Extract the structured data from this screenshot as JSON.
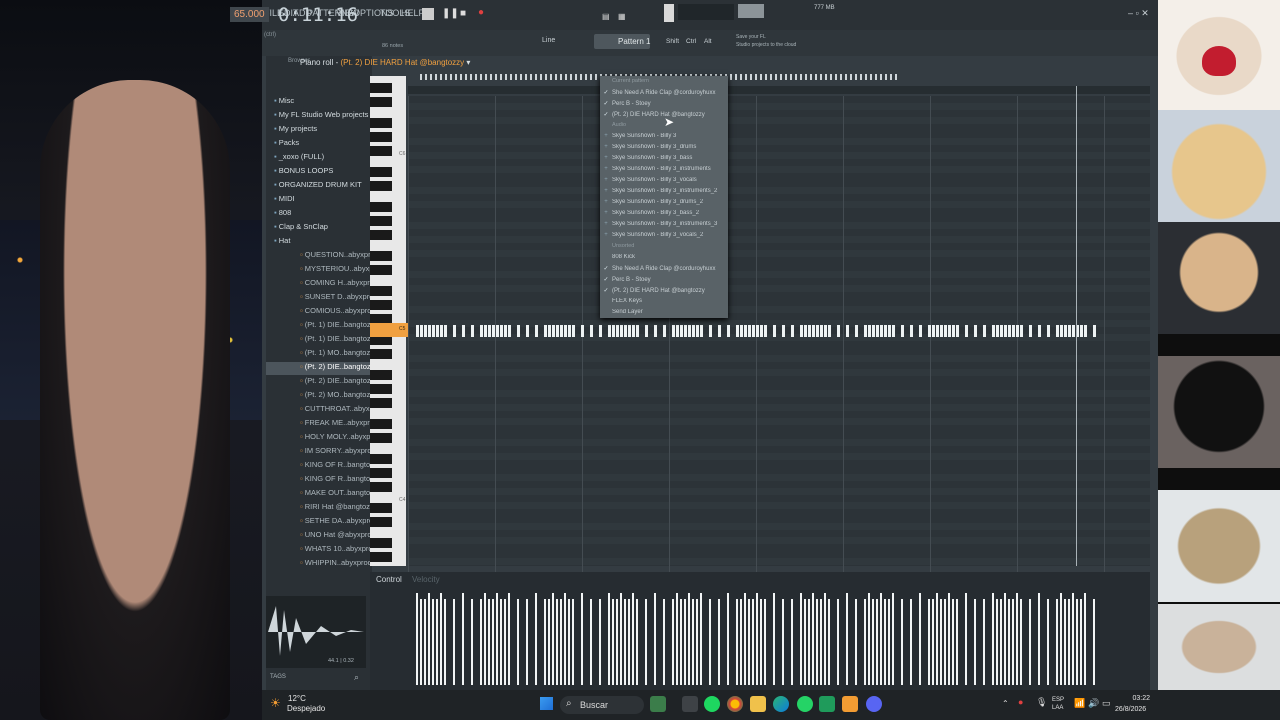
{
  "menu": [
    "FILE",
    "EDIT",
    "ADD",
    "PATTERNS",
    "VIEW",
    "OPTIONS",
    "TOOLS",
    "HELP"
  ],
  "transport": {
    "tempo": "65.000",
    "time": "0:11:16",
    "memory": "777 MB"
  },
  "hint": {
    "title": "Save your FL",
    "subtitle": "Studio projects to the cloud"
  },
  "toolbar": {
    "notes": "86 notes",
    "pattern": "Pattern 1",
    "snap": "Line",
    "shift": "Shift",
    "alt": "Alt"
  },
  "piano_roll": {
    "label": "Piano roll",
    "channel": "(Pt. 2) DIE HARD Hat @bangtozzy",
    "octave_c6": "C6",
    "octave_c5": "C5",
    "octave_c4": "C4",
    "control_label": "Control",
    "velocity_label": "Velocity"
  },
  "browser": {
    "search": "Browser",
    "items": [
      {
        "label": "Misc",
        "type": "folder"
      },
      {
        "label": "My FL Studio Web projects",
        "type": "folder"
      },
      {
        "label": "My projects",
        "type": "folder"
      },
      {
        "label": "Packs",
        "type": "folder"
      },
      {
        "label": "_xoxo (FULL)",
        "type": "folder"
      },
      {
        "label": "BONUS LOOPS",
        "type": "folder"
      },
      {
        "label": "ORGANIZED DRUM KIT",
        "type": "folder"
      },
      {
        "label": "MIDI",
        "type": "folder"
      },
      {
        "label": "808",
        "type": "folder"
      },
      {
        "label": "Clap & SnClap",
        "type": "folder"
      },
      {
        "label": "Hat",
        "type": "folder"
      },
      {
        "label": "QUESTION..abyxprod",
        "type": "file"
      },
      {
        "label": "MYSTERIOU..abyxprod",
        "type": "file"
      },
      {
        "label": "COMING H..abyxprod",
        "type": "file"
      },
      {
        "label": "SUNSET D..abyxprod",
        "type": "file"
      },
      {
        "label": "COMIOUS..abyxprod",
        "type": "file"
      },
      {
        "label": "(Pt. 1) DIE..bangtozzy",
        "type": "file"
      },
      {
        "label": "(Pt. 1) DIE..bangtozzy",
        "type": "file"
      },
      {
        "label": "(Pt. 1) MO..bangtozzy",
        "type": "file"
      },
      {
        "label": "(Pt. 2) DIE..bangtozzy",
        "type": "file",
        "selected": true
      },
      {
        "label": "(Pt. 2) DIE..bangtozzy",
        "type": "file"
      },
      {
        "label": "(Pt. 2) MO..bangtozzy",
        "type": "file"
      },
      {
        "label": "CUTTHROAT..abyxprod",
        "type": "file"
      },
      {
        "label": "FREAK ME..abyxprod",
        "type": "file"
      },
      {
        "label": "HOLY MOLY..abyxprod",
        "type": "file"
      },
      {
        "label": "IM SORRY..abyxprod",
        "type": "file"
      },
      {
        "label": "KING OF R..bangtozzy",
        "type": "file"
      },
      {
        "label": "KING OF R..bangtozzy",
        "type": "file"
      },
      {
        "label": "MAKE OUT..bangtozzy",
        "type": "file"
      },
      {
        "label": "RIRI Hat @bangtozzy",
        "type": "file"
      },
      {
        "label": "SETHE DA..abyxprod",
        "type": "file"
      },
      {
        "label": "UNO Hat @abyxprod",
        "type": "file"
      },
      {
        "label": "WHATS 10..abyxprod",
        "type": "file"
      },
      {
        "label": "WHIPPIN..abyxprod",
        "type": "file"
      }
    ],
    "sample_info": "44.1 | 0.32",
    "tabs_label": "TAGS"
  },
  "dropdown": {
    "items": [
      {
        "label": "Current pattern",
        "kind": "head"
      },
      {
        "label": "She Need A Ride Clap @corduroyhuxx",
        "kind": "check"
      },
      {
        "label": "Perc B - Stoey",
        "kind": "check"
      },
      {
        "label": "(Pt. 2) DIE HARD Hat @bangtozzy",
        "kind": "check"
      },
      {
        "label": "Audio",
        "kind": "head"
      },
      {
        "label": "Skye Sunshown - Billy 3",
        "kind": "plus"
      },
      {
        "label": "Skye Sunshown - Billy 3_drums",
        "kind": "plus"
      },
      {
        "label": "Skye Sunshown - Billy 3_bass",
        "kind": "plus"
      },
      {
        "label": "Skye Sunshown - Billy 3_instruments",
        "kind": "plus"
      },
      {
        "label": "Skye Sunshown - Billy 3_vocals",
        "kind": "plus"
      },
      {
        "label": "Skye Sunshown - Billy 3_instruments_2",
        "kind": "plus"
      },
      {
        "label": "Skye Sunshown - Billy 3_drums_2",
        "kind": "plus"
      },
      {
        "label": "Skye Sunshown - Billy 3_bass_2",
        "kind": "plus"
      },
      {
        "label": "Skye Sunshown - Billy 3_instruments_3",
        "kind": "plus"
      },
      {
        "label": "Skye Sunshown - Billy 3_vocals_2",
        "kind": "plus"
      },
      {
        "label": "Unsorted",
        "kind": "head"
      },
      {
        "label": "808 Kick",
        "kind": "plain"
      },
      {
        "label": "She Need A Ride Clap @corduroyhuxx",
        "kind": "check"
      },
      {
        "label": "Perc B - Stoey",
        "kind": "check"
      },
      {
        "label": "(Pt. 2) DIE HARD Hat @bangtozzy",
        "kind": "check"
      },
      {
        "label": "FLEX Keys",
        "kind": "plain"
      },
      {
        "label": "Send Layer",
        "kind": "plain"
      }
    ]
  },
  "taskbar": {
    "temperature": "12°C",
    "weather": "Despejado",
    "search": "Buscar",
    "lang_top": "ESP",
    "lang_bottom": "LAA",
    "time": "03:22",
    "date": "26/8/2026"
  },
  "colors": {
    "accent": "#f0a040",
    "note": "#eef3f4",
    "grid": "#2c3338",
    "panel": "#343c42"
  }
}
